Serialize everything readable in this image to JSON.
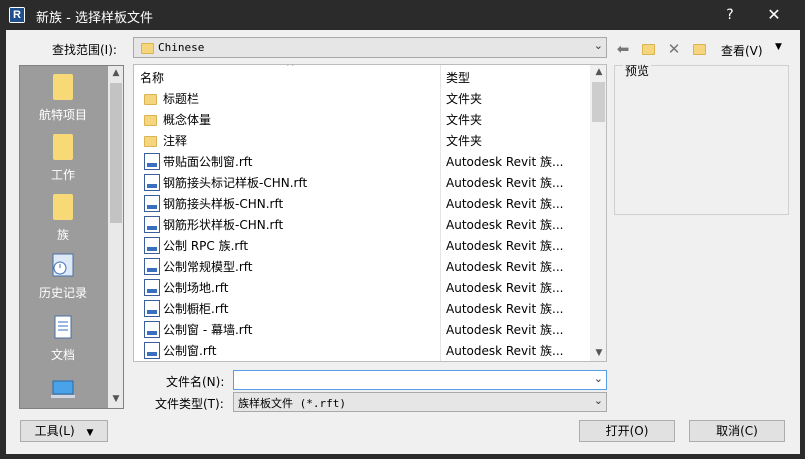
{
  "window": {
    "title": "新族 - 选择样板文件",
    "help": "?",
    "close": "✕"
  },
  "lookin": {
    "label": "查找范围(I):",
    "value": "Chinese"
  },
  "toolbar": {
    "view_label": "查看(V)"
  },
  "places": [
    {
      "label": "航特项目",
      "icon": "folder-icon"
    },
    {
      "label": "工作",
      "icon": "folder-icon"
    },
    {
      "label": "族",
      "icon": "folder-icon"
    },
    {
      "label": "历史记录",
      "icon": "history-icon"
    },
    {
      "label": "文档",
      "icon": "document-icon"
    }
  ],
  "columns": {
    "name": "名称",
    "type": "类型"
  },
  "files": [
    {
      "name": "标题栏",
      "type": "文件夹",
      "icon": "folder-icon"
    },
    {
      "name": "概念体量",
      "type": "文件夹",
      "icon": "folder-icon"
    },
    {
      "name": "注释",
      "type": "文件夹",
      "icon": "folder-icon"
    },
    {
      "name": "带贴面公制窗.rft",
      "type": "Autodesk Revit 族...",
      "icon": "rft-file-icon"
    },
    {
      "name": "钢筋接头标记样板-CHN.rft",
      "type": "Autodesk Revit 族...",
      "icon": "rft-file-icon"
    },
    {
      "name": "钢筋接头样板-CHN.rft",
      "type": "Autodesk Revit 族...",
      "icon": "rft-file-icon"
    },
    {
      "name": "钢筋形状样板-CHN.rft",
      "type": "Autodesk Revit 族...",
      "icon": "rft-file-icon"
    },
    {
      "name": "公制 RPC 族.rft",
      "type": "Autodesk Revit 族...",
      "icon": "rft-file-icon"
    },
    {
      "name": "公制常规模型.rft",
      "type": "Autodesk Revit 族...",
      "icon": "rft-file-icon"
    },
    {
      "name": "公制场地.rft",
      "type": "Autodesk Revit 族...",
      "icon": "rft-file-icon"
    },
    {
      "name": "公制橱柜.rft",
      "type": "Autodesk Revit 族...",
      "icon": "rft-file-icon"
    },
    {
      "name": "公制窗 - 幕墙.rft",
      "type": "Autodesk Revit 族...",
      "icon": "rft-file-icon"
    },
    {
      "name": "公制窗.rft",
      "type": "Autodesk Revit 族...",
      "icon": "rft-file-icon"
    }
  ],
  "preview": {
    "label": "预览"
  },
  "filename": {
    "label": "文件名(N):",
    "value": ""
  },
  "filetype": {
    "label": "文件类型(T):",
    "value": "族样板文件 (*.rft)"
  },
  "buttons": {
    "tools": "工具(L)",
    "open": "打开(O)",
    "cancel": "取消(C)"
  }
}
